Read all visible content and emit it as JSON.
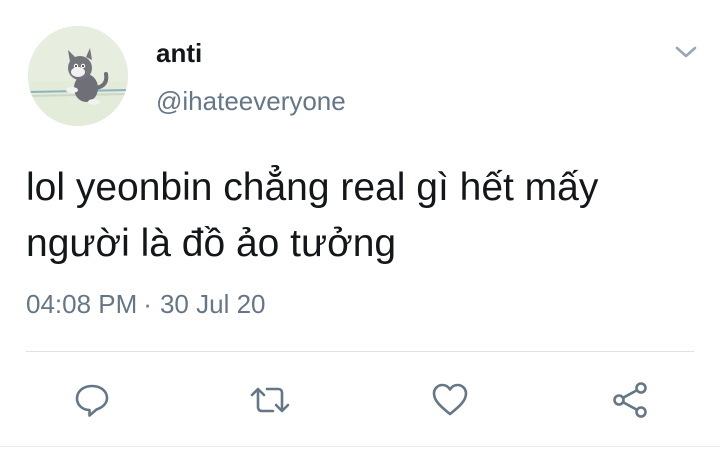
{
  "header": {
    "display_name": "anti",
    "handle": "@ihateeveryone",
    "avatar_icon": "cartoon-cat-avatar",
    "menu_icon": "chevron-down-icon"
  },
  "tweet": {
    "text_line1": "lol yeonbin chẳng real gì hết mấy",
    "text_line2": "người là đồ ảo tưởng",
    "time": "04:08 PM",
    "separator": "·",
    "date": "30 Jul 20"
  },
  "actions": [
    {
      "icon": "reply-icon"
    },
    {
      "icon": "retweet-icon"
    },
    {
      "icon": "like-heart-icon"
    },
    {
      "icon": "share-icon"
    }
  ],
  "colors": {
    "text_primary": "#14171a",
    "text_secondary": "#657786",
    "icon": "#657786",
    "divider": "#dfe3e7"
  }
}
